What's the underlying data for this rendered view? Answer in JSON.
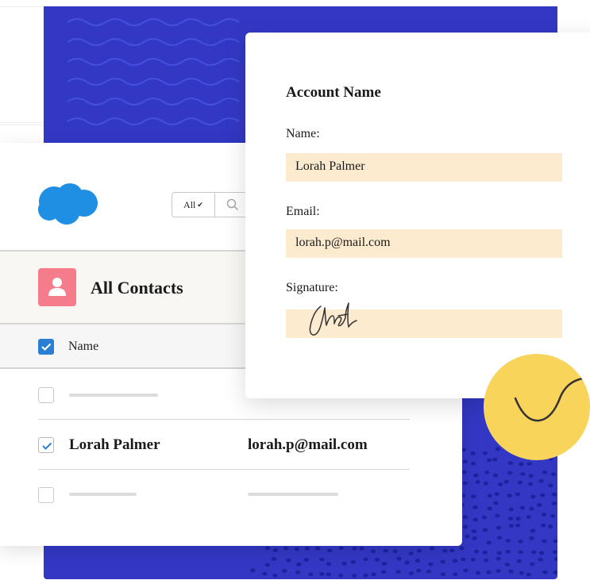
{
  "colors": {
    "blue_panel": "#3238c4",
    "accent_blue": "#2a7fd4",
    "contacts_icon": "#f47c8b",
    "field_bg": "#fdebd0",
    "yellow": "#f8d55a",
    "salesforce_cloud": "#1f8fe3"
  },
  "header": {
    "logo_icon": "salesforce-cloud-icon",
    "search_scope": "All",
    "search_icon": "search-icon"
  },
  "contacts": {
    "title": "All Contacts",
    "icon": "contact-person-icon",
    "column_name": "Name",
    "rows": [
      {
        "checked": false,
        "name": "",
        "email": ""
      },
      {
        "checked": true,
        "name": "Lorah Palmer",
        "email": "lorah.p@mail.com"
      },
      {
        "checked": false,
        "name": "",
        "email": ""
      }
    ]
  },
  "form": {
    "title": "Account Name",
    "name_label": "Name:",
    "name_value": "Lorah Palmer",
    "email_label": "Email:",
    "email_value": "lorah.p@mail.com",
    "signature_label": "Signature:",
    "signature_icon": "handwritten-signature"
  }
}
